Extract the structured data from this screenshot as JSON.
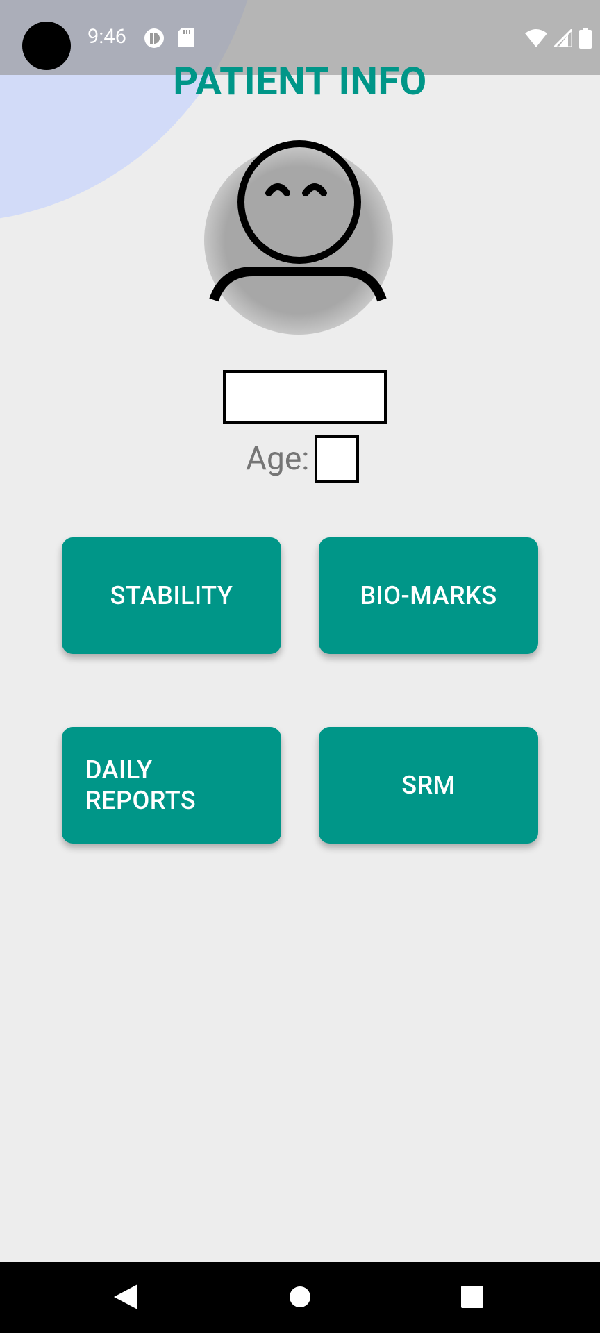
{
  "status_bar": {
    "time": "9:46",
    "left_icons": [
      "pie-icon",
      "sd-card-icon"
    ],
    "right_icons": [
      "wifi-icon",
      "signal-icon",
      "battery-icon"
    ]
  },
  "header": {
    "title": "PATIENT INFO"
  },
  "profile": {
    "avatar_icon": "person-icon",
    "name_value": "",
    "age_label": "Age:",
    "age_value": ""
  },
  "buttons": {
    "stability": "STABILITY",
    "biomarks": "BIO-MARKS",
    "daily_reports": "DAILY REPORTS",
    "srm": "SRM"
  },
  "nav_bar": {
    "icons": [
      "back-icon",
      "home-icon",
      "recents-icon"
    ]
  },
  "colors": {
    "accent": "#009688",
    "background": "#ededed",
    "blob": "#d2dbf8"
  }
}
